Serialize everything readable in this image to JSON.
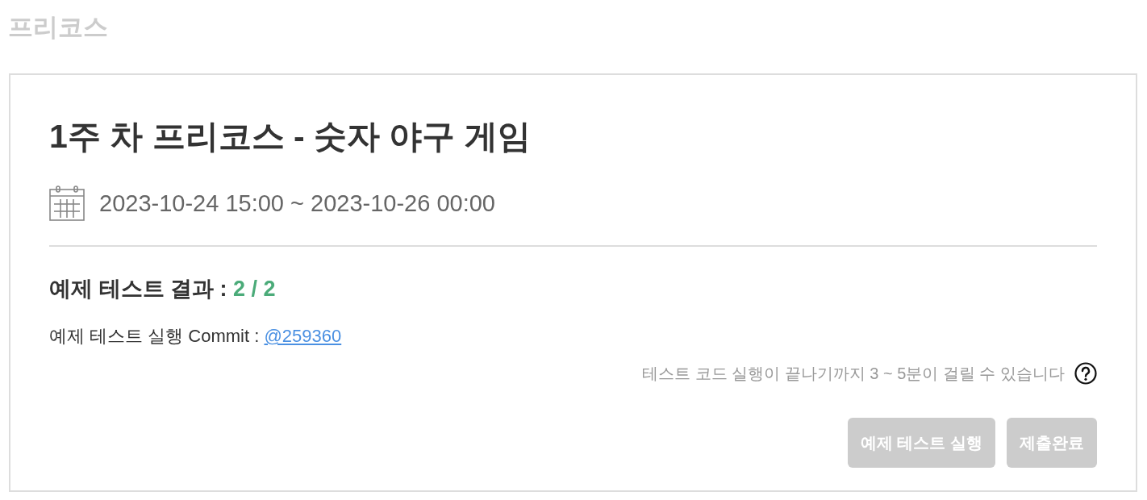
{
  "page": {
    "title": "프리코스"
  },
  "mission": {
    "title": "1주 차 프리코스 - 숫자 야구 게임",
    "period": "2023-10-24 15:00 ~ 2023-10-26 00:00"
  },
  "result": {
    "label": "예제 테스트 결과 :",
    "score": "2 / 2",
    "passed": true
  },
  "commit": {
    "label": "예제 테스트 실행 Commit :",
    "link": "@259360"
  },
  "hint": {
    "text": "테스트 코드 실행이 끝나기까지 3 ~ 5분이 걸릴 수 있습니다"
  },
  "buttons": [
    {
      "label": "예제 테스트 실행",
      "disabled": true
    },
    {
      "label": "제출완료",
      "disabled": true
    }
  ]
}
